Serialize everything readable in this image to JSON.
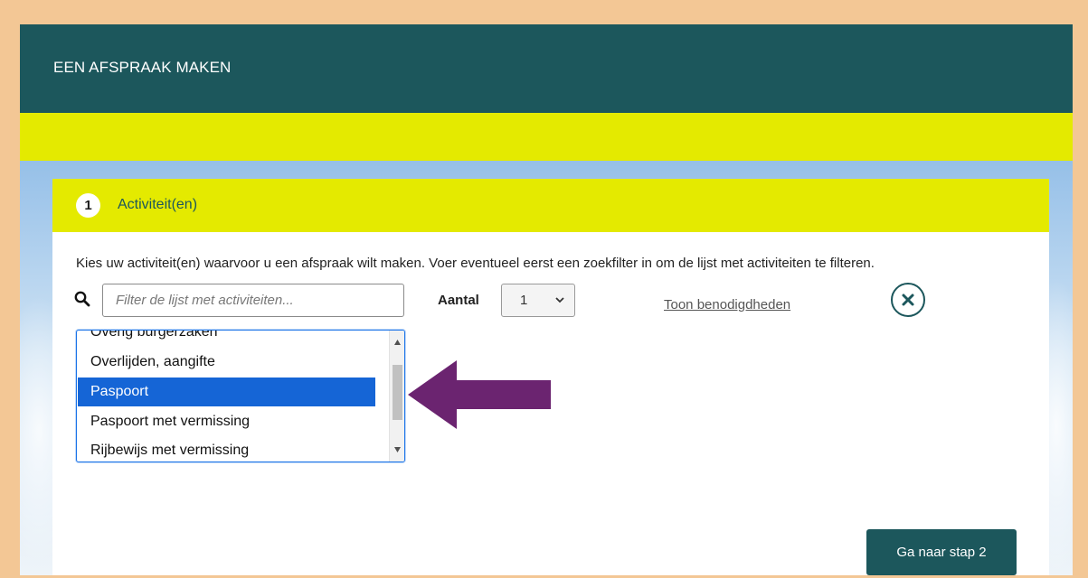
{
  "header": {
    "title": "EEN AFSPRAAK MAKEN"
  },
  "step": {
    "number": "1",
    "title": "Activiteit(en)",
    "instruction": "Kies uw activiteit(en) waarvoor u een afspraak wilt maken. Voer eventueel eerst een zoekfilter in om de lijst met activiteiten te filteren."
  },
  "filter": {
    "placeholder": "Filter de lijst met activiteiten...",
    "value": ""
  },
  "aantal": {
    "label": "Aantal",
    "selected": "1"
  },
  "toon_link": "Toon benodigdheden",
  "activities": {
    "items": [
      {
        "label": "Overig burgerzaken"
      },
      {
        "label": "Overlijden, aangifte"
      },
      {
        "label": "Paspoort",
        "selected": true
      },
      {
        "label": "Paspoort met vermissing"
      },
      {
        "label": "Rijbewijs met vermissing"
      }
    ]
  },
  "next_button": "Ga naar stap 2",
  "icons": {
    "search": "search-icon",
    "clear": "close-circle-icon",
    "select_chevron": "chevron-down-icon",
    "scroll_up": "scroll-up-icon",
    "scroll_down": "scroll-down-icon",
    "annotation_arrow": "arrow-left-icon"
  },
  "colors": {
    "header": "#1c575c",
    "yellow": "#e4ea00",
    "selected": "#1565d6",
    "frame": "#f3c795",
    "arrow": "#6b2470"
  }
}
